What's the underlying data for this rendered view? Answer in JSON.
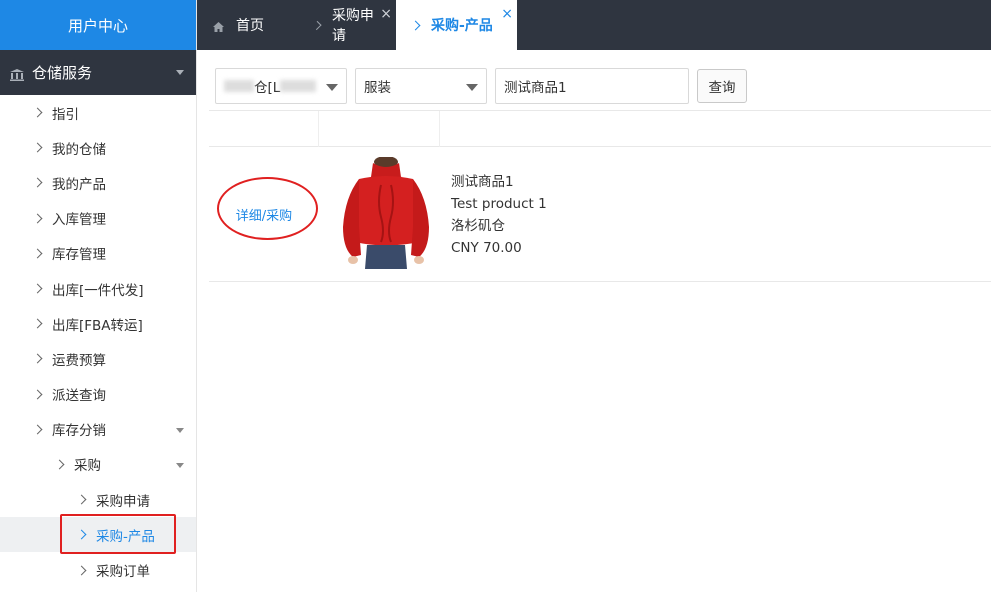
{
  "sidebar": {
    "brand": "用户中心",
    "section": "仓储服务",
    "items": [
      {
        "label": "指引"
      },
      {
        "label": "我的仓储"
      },
      {
        "label": "我的产品"
      },
      {
        "label": "入库管理"
      },
      {
        "label": "库存管理"
      },
      {
        "label": "出库[一件代发]"
      },
      {
        "label": "出库[FBA转运]"
      },
      {
        "label": "运费预算"
      },
      {
        "label": "派送查询"
      },
      {
        "label": "库存分销"
      },
      {
        "label": "采购"
      },
      {
        "label": "采购申请"
      },
      {
        "label": "采购-产品"
      },
      {
        "label": "采购订单"
      }
    ]
  },
  "tabs": [
    {
      "label": "首页"
    },
    {
      "label": "采购申请"
    },
    {
      "label": "采购-产品"
    }
  ],
  "filters": {
    "warehouse_prefix": "",
    "warehouse_mid": "仓[L",
    "category": "服装",
    "keyword": "测试商品1",
    "query_button": "查询"
  },
  "product": {
    "action": "详细/采购",
    "name_cn": "测试商品1",
    "name_en": "Test product 1",
    "warehouse": "洛杉矶仓",
    "price": "CNY 70.00"
  },
  "colors": {
    "primary": "#1e88e5",
    "dark_bar": "#2f3540",
    "highlight": "#e02020"
  }
}
